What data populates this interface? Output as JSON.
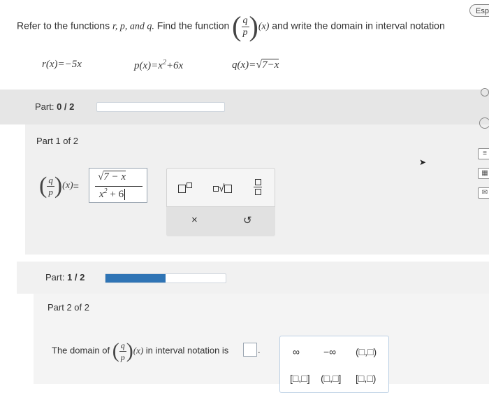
{
  "header": {
    "lang_button": "Esp",
    "problem_prefix": "Refer to the functions",
    "problem_vars": "r, p, and q.",
    "problem_find": "Find the function",
    "problem_suffix": "and write the domain in interval notation"
  },
  "functions": {
    "r": "r(x)=−5x",
    "p": "p(x)=x",
    "p_exp": "2",
    "p_rest": "+6x",
    "q": "q(x)=",
    "q_rad": "7−x"
  },
  "part1_bar": {
    "label_prefix": "Part: ",
    "label_value": "0 / 2",
    "progress_fraction": 0.0
  },
  "part1": {
    "title": "Part 1 of 2",
    "answer_num_rad": "7 − x",
    "answer_den": "x",
    "answer_den_exp": "2",
    "answer_den_rest": " + 6",
    "equals": "="
  },
  "palette": {
    "undo_icon": "undo-icon",
    "clear_icon": "x-icon",
    "clear_symbol": "×",
    "undo_symbol": "↺"
  },
  "part2_bar": {
    "label_prefix": "Part: ",
    "label_value": "1 / 2",
    "progress_fraction": 0.5
  },
  "part2": {
    "title": "Part 2 of 2",
    "prompt_prefix": "The domain of",
    "prompt_suffix": "in interval notation is",
    "period": "."
  },
  "symbols": {
    "infinity": "∞",
    "neg_infinity": "−∞",
    "open_open": "(□,□)",
    "closed_closed": "[□,□]",
    "open_closed": "(□,□]",
    "closed_open": "[□,□)"
  },
  "fraction": {
    "num": "q",
    "den": "p",
    "arg": "(x)"
  },
  "colors": {
    "progress": "#2f74b5",
    "panel": "#f0f0f0",
    "bar": "#e6e6e6"
  }
}
